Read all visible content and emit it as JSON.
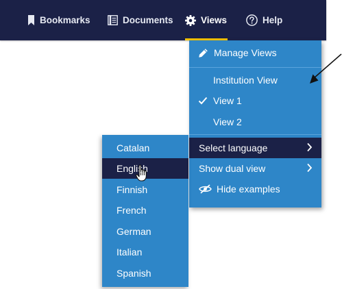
{
  "colors": {
    "navbar_bg": "#1b2147",
    "menu_bg": "#2e86c8",
    "selected_bg": "#1b2147",
    "active_underline": "#f2c200",
    "text": "#ffffff"
  },
  "navbar": {
    "items": [
      {
        "label": "Bookmarks",
        "icon": "bookmark-icon"
      },
      {
        "label": "Documents",
        "icon": "documents-icon"
      },
      {
        "label": "Views",
        "icon": "gear-icon",
        "active": true
      },
      {
        "label": "Help",
        "icon": "help-icon"
      }
    ]
  },
  "views_menu": {
    "manage_views": {
      "label": "Manage Views",
      "icon": "pencil-icon"
    },
    "views": [
      {
        "label": "Institution View",
        "checked": false
      },
      {
        "label": "View 1",
        "checked": true
      },
      {
        "label": "View 2",
        "checked": false
      }
    ],
    "select_language": {
      "label": "Select language",
      "icon": "chevron-right-icon"
    },
    "show_dual_view": {
      "label": "Show dual view",
      "icon": "chevron-right-icon"
    },
    "hide_examples": {
      "label": "Hide examples",
      "icon": "eye-slash-icon"
    }
  },
  "language_menu": {
    "items": [
      "Catalan",
      "English",
      "Finnish",
      "French",
      "German",
      "Italian",
      "Spanish"
    ],
    "hovered": "English"
  }
}
